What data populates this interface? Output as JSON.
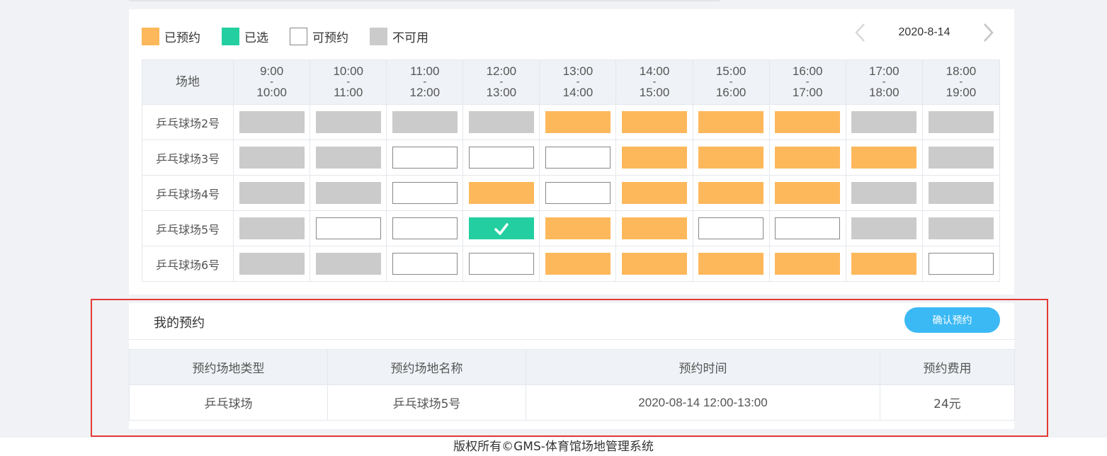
{
  "legend": [
    {
      "label": "已预约",
      "status": "booked",
      "color": "#fdb85c"
    },
    {
      "label": "已选",
      "status": "selected",
      "color": "#23cfa0"
    },
    {
      "label": "可预约",
      "status": "available",
      "color": "#ffffff"
    },
    {
      "label": "不可用",
      "status": "unavailable",
      "color": "#cbcbcb"
    }
  ],
  "date_nav": {
    "date": "2020-8-14",
    "prev_icon": "chevron-left-icon",
    "next_icon": "chevron-right-icon"
  },
  "grid": {
    "venue_header": "场地",
    "time_slots": [
      {
        "start": "9:00",
        "sep": "-",
        "end": "10:00"
      },
      {
        "start": "10:00",
        "sep": "-",
        "end": "11:00"
      },
      {
        "start": "11:00",
        "sep": "-",
        "end": "12:00"
      },
      {
        "start": "12:00",
        "sep": "-",
        "end": "13:00"
      },
      {
        "start": "13:00",
        "sep": "-",
        "end": "14:00"
      },
      {
        "start": "14:00",
        "sep": "-",
        "end": "15:00"
      },
      {
        "start": "15:00",
        "sep": "-",
        "end": "16:00"
      },
      {
        "start": "16:00",
        "sep": "-",
        "end": "17:00"
      },
      {
        "start": "17:00",
        "sep": "-",
        "end": "18:00"
      },
      {
        "start": "18:00",
        "sep": "-",
        "end": "19:00"
      }
    ],
    "rows": [
      {
        "venue": "乒乓球场2号",
        "slots": [
          "unavailable",
          "unavailable",
          "unavailable",
          "unavailable",
          "booked",
          "booked",
          "booked",
          "booked",
          "unavailable",
          "unavailable"
        ]
      },
      {
        "venue": "乒乓球场3号",
        "slots": [
          "unavailable",
          "unavailable",
          "available",
          "available",
          "available",
          "booked",
          "booked",
          "booked",
          "booked",
          "unavailable"
        ]
      },
      {
        "venue": "乒乓球场4号",
        "slots": [
          "unavailable",
          "unavailable",
          "available",
          "booked",
          "available",
          "booked",
          "booked",
          "booked",
          "unavailable",
          "unavailable"
        ]
      },
      {
        "venue": "乒乓球场5号",
        "slots": [
          "unavailable",
          "available",
          "available",
          "selected",
          "booked",
          "booked",
          "available",
          "available",
          "unavailable",
          "unavailable"
        ]
      },
      {
        "venue": "乒乓球场6号",
        "slots": [
          "unavailable",
          "unavailable",
          "available",
          "available",
          "booked",
          "booked",
          "booked",
          "booked",
          "booked",
          "available"
        ]
      }
    ]
  },
  "my_booking": {
    "title": "我的预约",
    "confirm_label": "确认预约",
    "columns": [
      "预约场地类型",
      "预约场地名称",
      "预约时间",
      "预约费用"
    ],
    "rows": [
      [
        "乒乓球场",
        "乒乓球场5号",
        "2020-08-14 12:00-13:00",
        "24元"
      ]
    ]
  },
  "footer": {
    "text": "版权所有©GMS-体育馆场地管理系统"
  }
}
